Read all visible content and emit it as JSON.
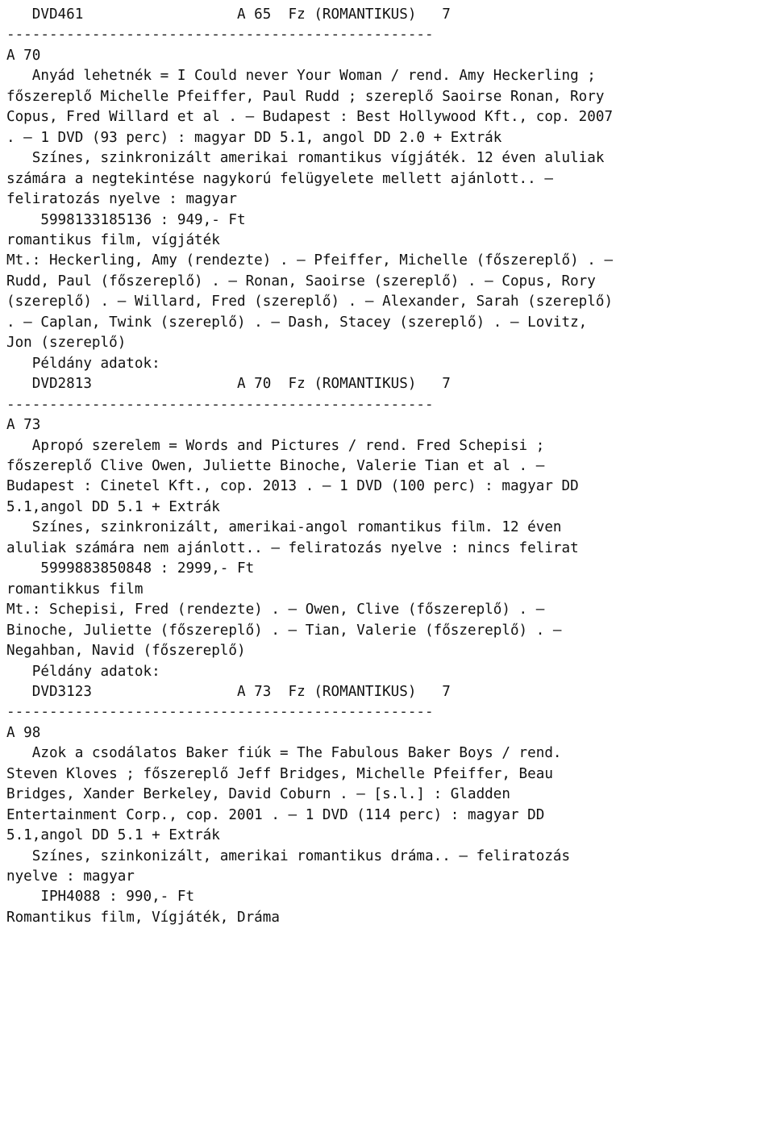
{
  "document": {
    "type": "library-catalog-print",
    "language": "hu",
    "separator_rule": "--------------------------------------------------"
  },
  "lines": [
    {
      "id": "l01",
      "name": "copy-record-dvd461",
      "text": "   DVD461                  A 65  Fz (ROMANTIKUS)   7"
    },
    {
      "id": "l02",
      "name": "blank",
      "text": ""
    },
    {
      "id": "l03",
      "name": "section-separator-1",
      "text": "--------------------------------------------------"
    },
    {
      "id": "l04",
      "name": "blank",
      "text": ""
    },
    {
      "id": "l05",
      "name": "shelfmark-a70",
      "text": "A 70"
    },
    {
      "id": "l06",
      "name": "blank",
      "text": ""
    },
    {
      "id": "l07",
      "name": "title-a70-line1",
      "text": "   Anyád lehetnék = I Could never Your Woman / rend. Amy Heckerling ;"
    },
    {
      "id": "l08",
      "name": "title-a70-line2",
      "text": "főszereplő Michelle Pfeiffer, Paul Rudd ; szereplő Saoirse Ronan, Rory"
    },
    {
      "id": "l09",
      "name": "title-a70-line3",
      "text": "Copus, Fred Willard et al . — Budapest : Best Hollywood Kft., cop. 2007"
    },
    {
      "id": "l10",
      "name": "title-a70-line4",
      "text": ". — 1 DVD (93 perc) : magyar DD 5.1, angol DD 2.0 + Extrák"
    },
    {
      "id": "l11",
      "name": "note-a70-line1",
      "text": "   Színes, szinkronizált amerikai romantikus vígjáték. 12 éven aluliak"
    },
    {
      "id": "l12",
      "name": "note-a70-line2",
      "text": "számára a negtekintése nagykorú felügyelete mellett ajánlott.. —"
    },
    {
      "id": "l13",
      "name": "note-a70-line3",
      "text": "feliratozás nyelve : magyar"
    },
    {
      "id": "l14",
      "name": "isbn-price-a70",
      "text": "    5998133185136 : 949,- Ft"
    },
    {
      "id": "l15",
      "name": "subject-a70",
      "text": "romantikus film, vígjáték"
    },
    {
      "id": "l16",
      "name": "contributors-a70-line1",
      "text": "Mt.: Heckerling, Amy (rendezte) . — Pfeiffer, Michelle (főszereplő) . —"
    },
    {
      "id": "l17",
      "name": "contributors-a70-line2",
      "text": "Rudd, Paul (főszereplő) . — Ronan, Saoirse (szereplő) . — Copus, Rory"
    },
    {
      "id": "l18",
      "name": "contributors-a70-line3",
      "text": "(szereplő) . — Willard, Fred (szereplő) . — Alexander, Sarah (szereplő)"
    },
    {
      "id": "l19",
      "name": "contributors-a70-line4",
      "text": ". — Caplan, Twink (szereplő) . — Dash, Stacey (szereplő) . — Lovitz,"
    },
    {
      "id": "l20",
      "name": "contributors-a70-line5",
      "text": "Jon (szereplő)"
    },
    {
      "id": "l21",
      "name": "blank",
      "text": ""
    },
    {
      "id": "l22",
      "name": "copy-data-heading-a70",
      "text": "   Példány adatok:"
    },
    {
      "id": "l23",
      "name": "copy-record-dvd2813",
      "text": "   DVD2813                 A 70  Fz (ROMANTIKUS)   7"
    },
    {
      "id": "l24",
      "name": "blank",
      "text": ""
    },
    {
      "id": "l25",
      "name": "section-separator-2",
      "text": "--------------------------------------------------"
    },
    {
      "id": "l26",
      "name": "blank",
      "text": ""
    },
    {
      "id": "l27",
      "name": "shelfmark-a73",
      "text": "A 73"
    },
    {
      "id": "l28",
      "name": "blank",
      "text": ""
    },
    {
      "id": "l29",
      "name": "title-a73-line1",
      "text": "   Apropó szerelem = Words and Pictures / rend. Fred Schepisi ;"
    },
    {
      "id": "l30",
      "name": "title-a73-line2",
      "text": "főszereplő Clive Owen, Juliette Binoche, Valerie Tian et al . —"
    },
    {
      "id": "l31",
      "name": "title-a73-line3",
      "text": "Budapest : Cinetel Kft., cop. 2013 . — 1 DVD (100 perc) : magyar DD"
    },
    {
      "id": "l32",
      "name": "title-a73-line4",
      "text": "5.1,angol DD 5.1 + Extrák"
    },
    {
      "id": "l33",
      "name": "note-a73-line1",
      "text": "   Színes, szinkronizált, amerikai-angol romantikus film. 12 éven"
    },
    {
      "id": "l34",
      "name": "note-a73-line2",
      "text": "aluliak számára nem ajánlott.. — feliratozás nyelve : nincs felirat"
    },
    {
      "id": "l35",
      "name": "isbn-price-a73",
      "text": "    5999883850848 : 2999,- Ft"
    },
    {
      "id": "l36",
      "name": "subject-a73",
      "text": "romantikkus film"
    },
    {
      "id": "l37",
      "name": "contributors-a73-line1",
      "text": "Mt.: Schepisi, Fred (rendezte) . — Owen, Clive (főszereplő) . —"
    },
    {
      "id": "l38",
      "name": "contributors-a73-line2",
      "text": "Binoche, Juliette (főszereplő) . — Tian, Valerie (főszereplő) . —"
    },
    {
      "id": "l39",
      "name": "contributors-a73-line3",
      "text": "Negahban, Navid (főszereplő)"
    },
    {
      "id": "l40",
      "name": "blank",
      "text": ""
    },
    {
      "id": "l41",
      "name": "copy-data-heading-a73",
      "text": "   Példány adatok:"
    },
    {
      "id": "l42",
      "name": "copy-record-dvd3123",
      "text": "   DVD3123                 A 73  Fz (ROMANTIKUS)   7"
    },
    {
      "id": "l43",
      "name": "blank",
      "text": ""
    },
    {
      "id": "l44",
      "name": "section-separator-3",
      "text": "--------------------------------------------------"
    },
    {
      "id": "l45",
      "name": "blank",
      "text": ""
    },
    {
      "id": "l46",
      "name": "shelfmark-a98",
      "text": "A 98"
    },
    {
      "id": "l47",
      "name": "blank",
      "text": ""
    },
    {
      "id": "l48",
      "name": "title-a98-line1",
      "text": "   Azok a csodálatos Baker fiúk = The Fabulous Baker Boys / rend."
    },
    {
      "id": "l49",
      "name": "title-a98-line2",
      "text": "Steven Kloves ; főszereplő Jeff Bridges, Michelle Pfeiffer, Beau"
    },
    {
      "id": "l50",
      "name": "title-a98-line3",
      "text": "Bridges, Xander Berkeley, David Coburn . — [s.l.] : Gladden"
    },
    {
      "id": "l51",
      "name": "title-a98-line4",
      "text": "Entertainment Corp., cop. 2001 . — 1 DVD (114 perc) : magyar DD"
    },
    {
      "id": "l52",
      "name": "title-a98-line5",
      "text": "5.1,angol DD 5.1 + Extrák"
    },
    {
      "id": "l53",
      "name": "note-a98-line1",
      "text": "   Színes, szinkonizált, amerikai romantikus dráma.. — feliratozás"
    },
    {
      "id": "l54",
      "name": "note-a98-line2",
      "text": "nyelve : magyar"
    },
    {
      "id": "l55",
      "name": "isbn-price-a98",
      "text": "    IPH4088 : 990,- Ft"
    },
    {
      "id": "l56",
      "name": "subject-a98",
      "text": "Romantikus film, Vígjáték, Dráma"
    }
  ]
}
